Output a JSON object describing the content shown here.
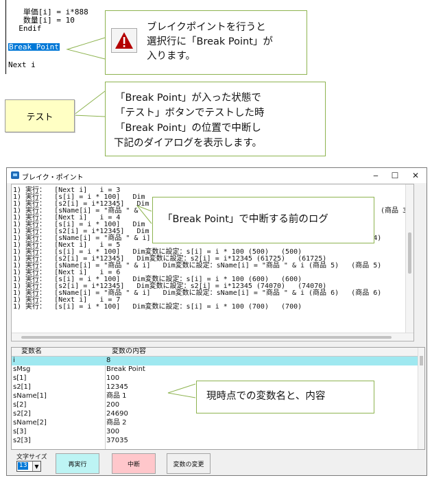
{
  "code": {
    "lines": [
      "   単価[i] = i*888",
      "   数量[i] = 10",
      "  Endif",
      "",
      "Break Point",
      "",
      "Next i"
    ]
  },
  "callout1": {
    "lines": [
      "ブレイクポイントを行うと",
      "選択行に「Break Point」が",
      "入ります。"
    ],
    "icon": "warning-triangle-icon",
    "icon_color": "#b40000"
  },
  "test_button": {
    "label": "テスト"
  },
  "callout2": {
    "lines": [
      "「Break Point」が入った状態で",
      "「テスト」ボタンでテストした時",
      "「Break Point」の位置で中断し",
      "下記のダイアログを表示します。"
    ]
  },
  "dialog": {
    "title": "ブレイク・ポイント",
    "controls": {
      "minimize": "‒",
      "maximize": "☐",
      "close": "✕"
    },
    "log_lines": [
      "1) 実行：  [Next i]   i = 3",
      "1) 実行：  [s[i] = i * 100]   Dim",
      "1) 実行：  [s2[i] = i*12345]   Dim",
      "1) 実行：  [sName[i] = \"商品 \" &",
      "1) 実行：  [Next i]   i = 4",
      "1) 実行：  [s[i] = i * 100]   Dim",
      "1) 実行：  [s2[i] = i*12345]   Dim",
      "1) 実行：  [sName[i] = \"商品 \" & i]   Dim変数に設定：sName[i] = \"商品 \" & i (商品 4)   (商品 4)",
      "1) 実行：  [Next i]   i = 5",
      "1) 実行：  [s[i] = i * 100]   Dim変数に設定：s[i] = i * 100 (500)   (500)",
      "1) 実行：  [s2[i] = i*12345]   Dim変数に設定：s2[i] = i*12345 (61725)   (61725)",
      "1) 実行：  [sName[i] = \"商品 \" & i]   Dim変数に設定：sName[i] = \"商品 \" & i (商品 5)   (商品 5)",
      "1) 実行：  [Next i]   i = 6",
      "1) 実行：  [s[i] = i * 100]   Dim変数に設定：s[i] = i * 100 (600)   (600)",
      "1) 実行：  [s2[i] = i*12345]   Dim変数に設定：s2[i] = i*12345 (74070)   (74070)",
      "1) 実行：  [sName[i] = \"商品 \" & i]   Dim変数に設定：sName[i] = \"商品 \" & i (商品 6)   (商品 6)",
      "1) 実行：  [Next i]   i = 7",
      "1) 実行：  [s[i] = i * 100]   Dim変数に設定：s[i] = i * 100 (700)   (700)"
    ],
    "log_right_fragment": "(商品 3)",
    "log_callout": "「Break Point」で中断する前のログ",
    "table": {
      "headers": [
        "変数名",
        "変数の内容"
      ],
      "rows": [
        [
          "i",
          "8"
        ],
        [
          "sMsg",
          "Break Point"
        ],
        [
          "s[1]",
          "100"
        ],
        [
          "s2[1]",
          "12345"
        ],
        [
          "sName[1]",
          "商品 1"
        ],
        [
          "s[2]",
          "200"
        ],
        [
          "s2[2]",
          "24690"
        ],
        [
          "sName[2]",
          "商品 2"
        ],
        [
          "s[3]",
          "300"
        ],
        [
          "s2[3]",
          "37035"
        ]
      ]
    },
    "table_callout": "現時点での変数名と、内容",
    "font_size_label": "文字サイズ",
    "font_size_value": "13",
    "buttons": {
      "resume": {
        "label": "再実行",
        "color": "#bdf4f4"
      },
      "abort": {
        "label": "中断",
        "color": "#ffc7cb"
      },
      "change_var": {
        "label": "変数の変更",
        "color": "#f0f0f0"
      }
    }
  }
}
